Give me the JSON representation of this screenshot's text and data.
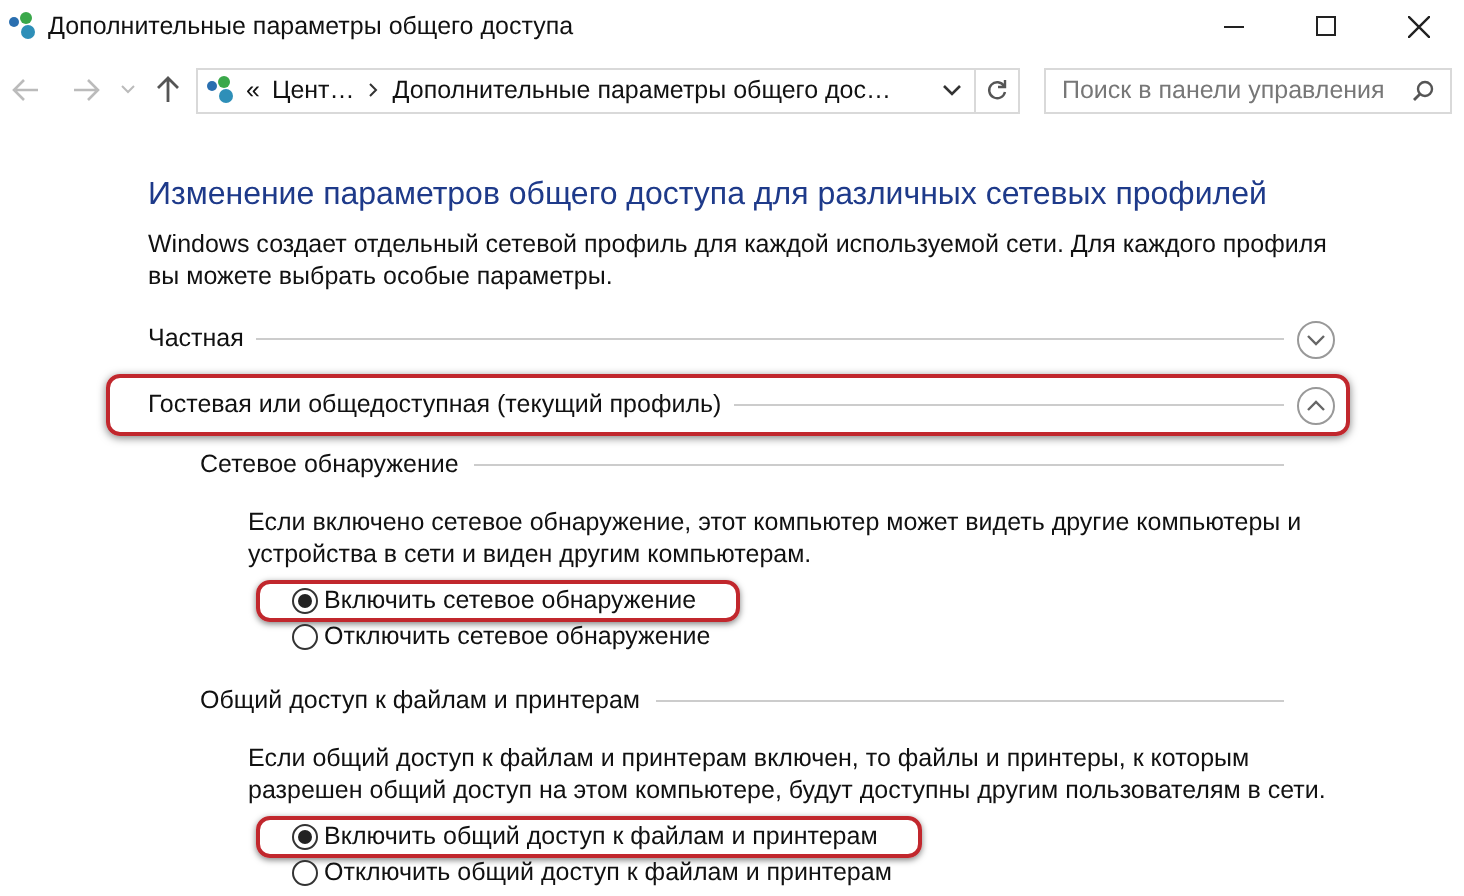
{
  "window": {
    "title": "Дополнительные параметры общего доступа"
  },
  "address_bar": {
    "overflow": "«",
    "breadcrumb": [
      "Цент…",
      "Дополнительные параметры общего дос…"
    ]
  },
  "search": {
    "placeholder": "Поиск в панели управления"
  },
  "heading": "Изменение параметров общего доступа для различных сетевых профилей",
  "description": "Windows создает отдельный сетевой профиль для каждой используемой сети. Для каждого профиля вы можете выбрать особые параметры.",
  "profiles": [
    {
      "label": "Частная",
      "expanded": false,
      "highlighted": false
    },
    {
      "label": "Гостевая или общедоступная (текущий профиль)",
      "expanded": true,
      "highlighted": true,
      "sections": [
        {
          "title": "Сетевое обнаружение",
          "description": "Если включено сетевое обнаружение, этот компьютер может видеть другие компьютеры и устройства в сети и виден другим компьютерам.",
          "options": [
            {
              "label": "Включить сетевое обнаружение",
              "selected": true,
              "highlighted": true
            },
            {
              "label": "Отключить сетевое обнаружение",
              "selected": false,
              "highlighted": false
            }
          ]
        },
        {
          "title": "Общий доступ к файлам и принтерам",
          "description": "Если общий доступ к файлам и принтерам включен, то файлы и принтеры, к которым разрешен общий доступ на этом компьютере, будут доступны другим пользователям в сети.",
          "options": [
            {
              "label": "Включить общий доступ к файлам и принтерам",
              "selected": true,
              "highlighted": true
            },
            {
              "label": "Отключить общий доступ к файлам и принтерам",
              "selected": false,
              "highlighted": false
            }
          ]
        }
      ]
    }
  ]
}
